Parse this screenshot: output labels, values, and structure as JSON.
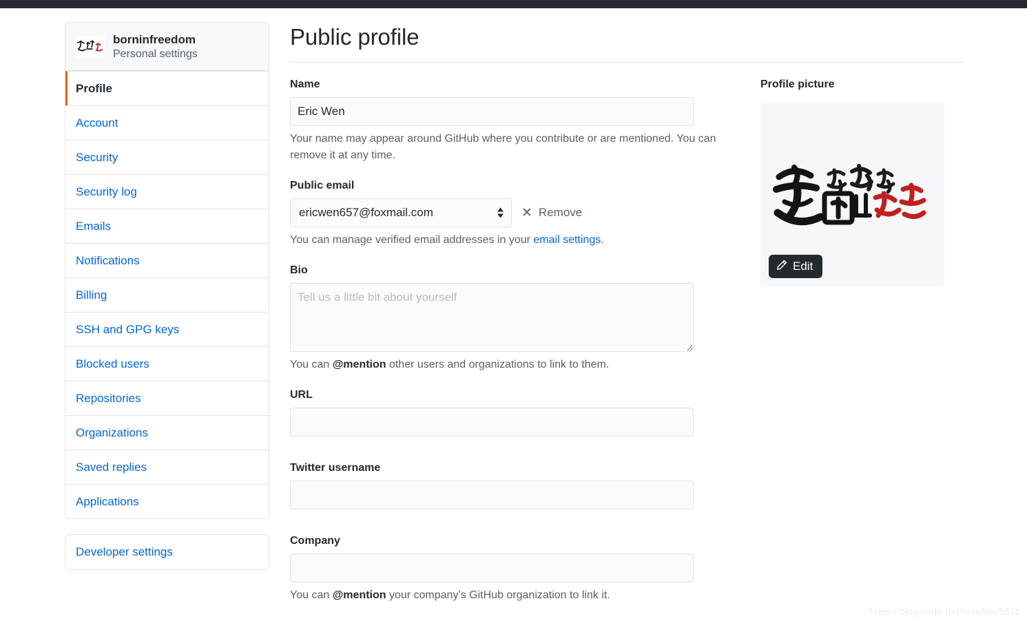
{
  "topbar": {
    "color": "#24292e"
  },
  "sidebar": {
    "user": {
      "name": "borninfreedom",
      "subtitle": "Personal settings",
      "avatar_icon": "calligraphy-avatar-icon"
    },
    "items": [
      {
        "label": "Profile",
        "active": true
      },
      {
        "label": "Account",
        "active": false
      },
      {
        "label": "Security",
        "active": false
      },
      {
        "label": "Security log",
        "active": false
      },
      {
        "label": "Emails",
        "active": false
      },
      {
        "label": "Notifications",
        "active": false
      },
      {
        "label": "Billing",
        "active": false
      },
      {
        "label": "SSH and GPG keys",
        "active": false
      },
      {
        "label": "Blocked users",
        "active": false
      },
      {
        "label": "Repositories",
        "active": false
      },
      {
        "label": "Organizations",
        "active": false
      },
      {
        "label": "Saved replies",
        "active": false
      },
      {
        "label": "Applications",
        "active": false
      }
    ],
    "developer_settings": {
      "label": "Developer settings"
    },
    "active_marker_color": "#e36209",
    "link_color": "#0366d6"
  },
  "main": {
    "title": "Public profile",
    "name_field": {
      "label": "Name",
      "value": "Eric Wen",
      "help": "Your name may appear around GitHub where you contribute or are mentioned. You can remove it at any time."
    },
    "email_field": {
      "label": "Public email",
      "selected": "ericwen657@foxmail.com",
      "options": [
        "ericwen657@foxmail.com"
      ],
      "remove_label": "Remove",
      "remove_icon": "close-x-icon",
      "help_prefix": "You can manage verified email addresses in your ",
      "help_link": "email settings",
      "help_suffix": "."
    },
    "bio_field": {
      "label": "Bio",
      "value": "",
      "placeholder": "Tell us a little bit about yourself",
      "help_prefix": "You can ",
      "help_bold": "@mention",
      "help_suffix": " other users and organizations to link to them."
    },
    "url_field": {
      "label": "URL",
      "value": "",
      "placeholder": ""
    },
    "twitter_field": {
      "label": "Twitter username",
      "value": "",
      "placeholder": ""
    },
    "company_field": {
      "label": "Company",
      "value": "",
      "placeholder": "",
      "help_prefix": "You can ",
      "help_bold": "@mention",
      "help_suffix": " your company’s GitHub organization to link it."
    }
  },
  "profile_picture": {
    "label": "Profile picture",
    "edit_label": "Edit",
    "edit_icon": "pencil-icon",
    "image_alt": "爱国 敬业 诚信 友善 calligraphy"
  },
  "watermark": {
    "text": "https://blog.csdn.net/bornfree5511"
  }
}
